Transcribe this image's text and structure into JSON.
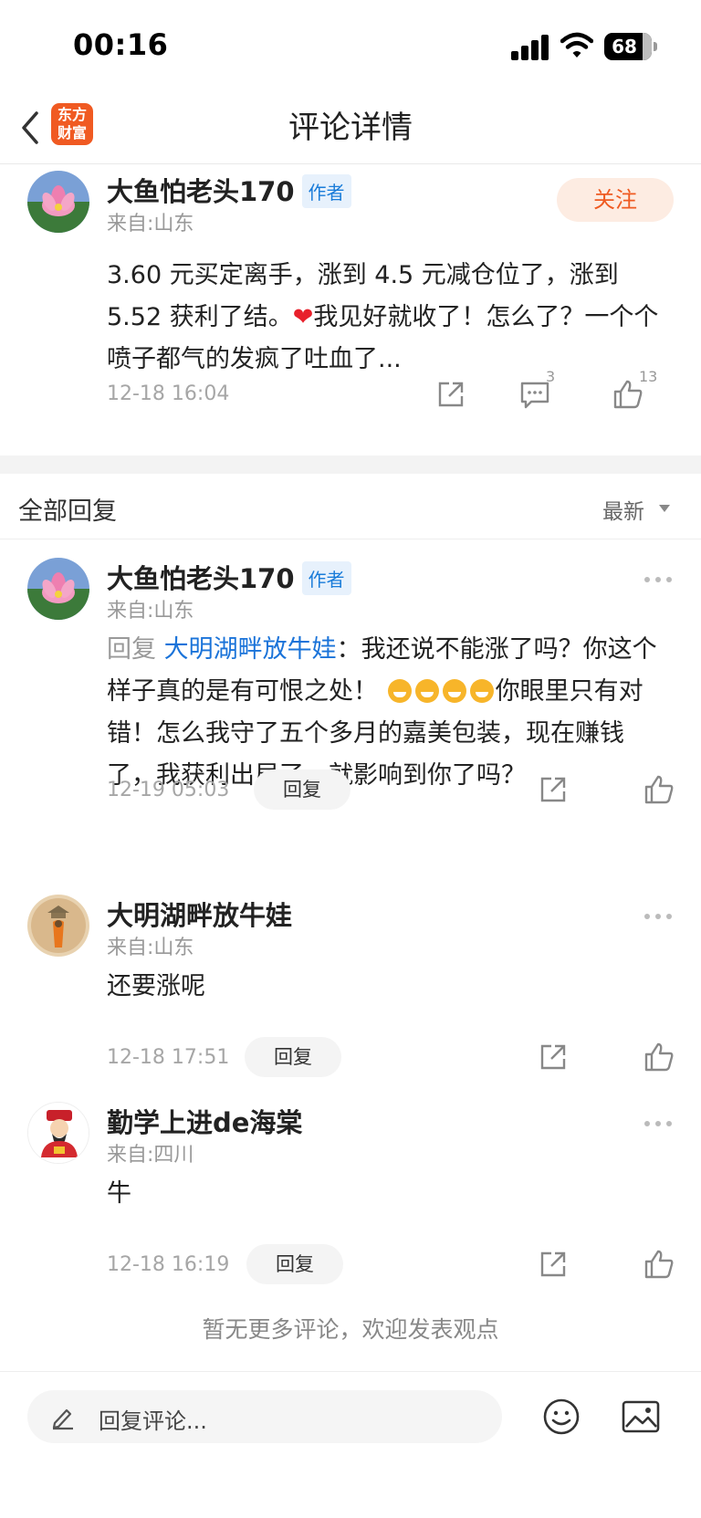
{
  "status_bar": {
    "time": "00:16",
    "battery": "68"
  },
  "nav": {
    "title": "评论详情",
    "logo_text_line1": "东方",
    "logo_text_line2": "财富"
  },
  "main_comment": {
    "username": "大鱼怕老头170",
    "badge": "作者",
    "location": "来自:山东",
    "follow_label": "关注",
    "text_part1": "3.60 元买定离手，涨到 4.5 元减仓位了，涨到 5.52 获利了结。",
    "heart": "❤",
    "text_part2": "我见好就收了！怎么了？一个个喷子都气的发疯了吐血了...",
    "date": "12-18 16:04",
    "comment_count": "3",
    "like_count": "13"
  },
  "replies_section": {
    "title": "全部回复",
    "sort_label": "最新"
  },
  "replies": [
    {
      "username": "大鱼怕老头170",
      "badge": "作者",
      "location": "来自:山东",
      "reply_prefix": "回复",
      "mention": "大明湖畔放牛娃",
      "text_part1": "：我还说不能涨了吗？你这个样子真的是有可恨之处！",
      "text_part2": "你眼里只有对错！怎么我守了五个多月的嘉美包装，现在赚钱了，我获利出局了，就影响到你了吗？",
      "date": "12-19 05:03",
      "reply_label": "回复"
    },
    {
      "username": "大明湖畔放牛娃",
      "location": "来自:山东",
      "text": "还要涨呢",
      "date": "12-18 17:51",
      "reply_label": "回复"
    },
    {
      "username": "勤学上进de海棠",
      "location": "来自:四川",
      "text": "牛",
      "date": "12-18 16:19",
      "reply_label": "回复"
    }
  ],
  "footer": {
    "no_more_text": "暂无更多评论，欢迎发表观点"
  },
  "input": {
    "placeholder": "回复评论..."
  },
  "colors": {
    "accent": "#ef5a21",
    "link": "#1a73d9",
    "badge_bg": "#e7f1fc"
  },
  "icons": [
    "back-icon",
    "share-icon",
    "comment-icon",
    "like-icon",
    "more-icon",
    "pencil-icon",
    "emoji-icon",
    "image-icon",
    "signal-icon",
    "wifi-icon",
    "battery-icon"
  ]
}
